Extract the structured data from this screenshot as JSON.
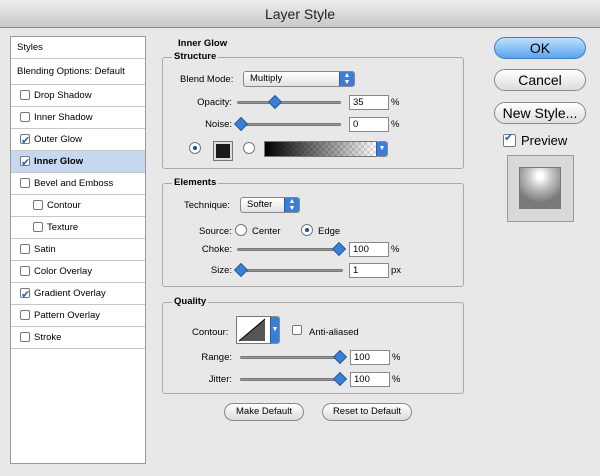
{
  "window": {
    "title": "Layer Style"
  },
  "styles_panel": {
    "header": "Styles",
    "blending": "Blending Options: Default",
    "items": [
      {
        "label": "Drop Shadow",
        "checked": false,
        "indent": false
      },
      {
        "label": "Inner Shadow",
        "checked": false,
        "indent": false
      },
      {
        "label": "Outer Glow",
        "checked": true,
        "indent": false
      },
      {
        "label": "Inner Glow",
        "checked": true,
        "indent": false,
        "selected": true
      },
      {
        "label": "Bevel and Emboss",
        "checked": false,
        "indent": false
      },
      {
        "label": "Contour",
        "checked": false,
        "indent": true
      },
      {
        "label": "Texture",
        "checked": false,
        "indent": true
      },
      {
        "label": "Satin",
        "checked": false,
        "indent": false
      },
      {
        "label": "Color Overlay",
        "checked": false,
        "indent": false
      },
      {
        "label": "Gradient Overlay",
        "checked": true,
        "indent": false
      },
      {
        "label": "Pattern Overlay",
        "checked": false,
        "indent": false
      },
      {
        "label": "Stroke",
        "checked": false,
        "indent": false
      }
    ]
  },
  "inner_glow": {
    "title": "Inner Glow",
    "structure": {
      "title": "Structure",
      "blend_mode_label": "Blend Mode:",
      "blend_mode_value": "Multiply",
      "opacity_label": "Opacity:",
      "opacity_value": "35",
      "opacity_level": 0.35,
      "noise_label": "Noise:",
      "noise_value": "0",
      "noise_level": 0,
      "percent": "%",
      "color": "#1a1a1a"
    },
    "elements": {
      "title": "Elements",
      "technique_label": "Technique:",
      "technique_value": "Softer",
      "source_label": "Source:",
      "source_center": "Center",
      "source_edge": "Edge",
      "source_selected": "Edge",
      "choke_label": "Choke:",
      "choke_value": "100",
      "choke_level": 1.0,
      "size_label": "Size:",
      "size_value": "1",
      "size_level": 0,
      "percent": "%",
      "px": "px"
    },
    "quality": {
      "title": "Quality",
      "contour_label": "Contour:",
      "anti_aliased_label": "Anti-aliased",
      "anti_aliased_checked": false,
      "range_label": "Range:",
      "range_value": "100",
      "range_level": 1.0,
      "jitter_label": "Jitter:",
      "jitter_value": "100",
      "jitter_level": 1.0,
      "percent": "%"
    },
    "make_default": "Make Default",
    "reset_default": "Reset to Default"
  },
  "buttons": {
    "ok": "OK",
    "cancel": "Cancel",
    "new_style": "New Style...",
    "preview_label": "Preview",
    "preview_checked": true
  }
}
